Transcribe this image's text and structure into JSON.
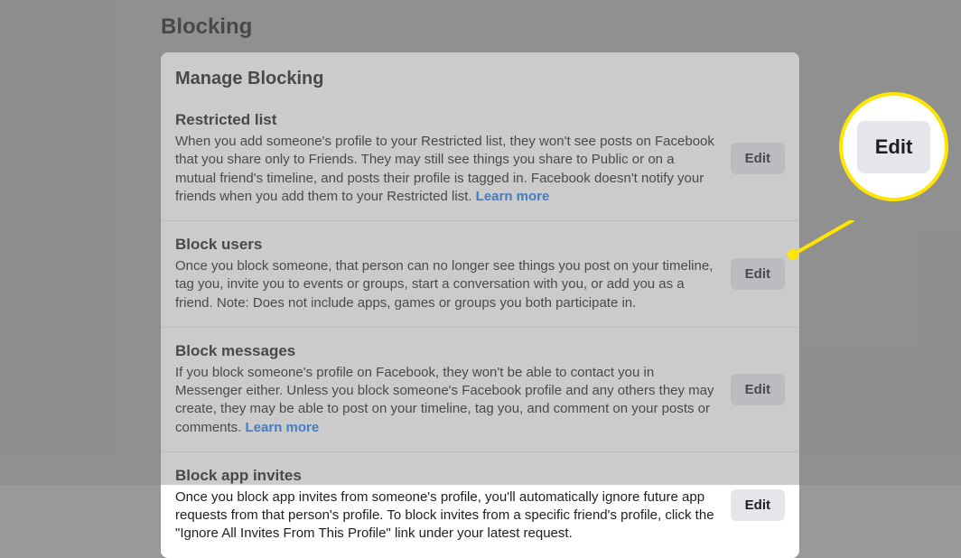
{
  "page": {
    "title": "Blocking",
    "card_title": "Manage Blocking",
    "learn_more_label": "Learn more",
    "edit_label": "Edit"
  },
  "sections": [
    {
      "title": "Restricted list",
      "desc": "When you add someone's profile to your Restricted list, they won't see posts on Facebook that you share only to Friends. They may still see things you share to Public or on a mutual friend's timeline, and posts their profile is tagged in. Facebook doesn't notify your friends when you add them to your Restricted list.",
      "has_learn_more": true
    },
    {
      "title": "Block users",
      "desc": "Once you block someone, that person can no longer see things you post on your timeline, tag you, invite you to events or groups, start a conversation with you, or add you as a friend. Note: Does not include apps, games or groups you both participate in.",
      "has_learn_more": false
    },
    {
      "title": "Block messages",
      "desc": "If you block someone's profile on Facebook, they won't be able to contact you in Messenger either. Unless you block someone's Facebook profile and any others they may create, they may be able to post on your timeline, tag you, and comment on your posts or comments.",
      "has_learn_more": true
    },
    {
      "title": "Block app invites",
      "desc": "Once you block app invites from someone's profile, you'll automatically ignore future app requests from that person's profile. To block invites from a specific friend's profile, click the \"Ignore All Invites From This Profile\" link under your latest request.",
      "has_learn_more": false
    }
  ],
  "highlight": {
    "label": "Edit"
  }
}
